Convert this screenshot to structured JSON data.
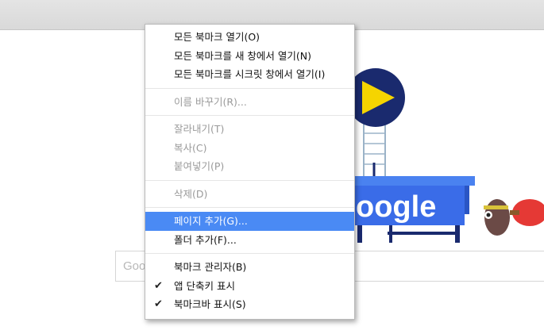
{
  "doodle": {
    "logo_text": "oogle",
    "colors": {
      "table_blue": "#3a6ce8",
      "play_circle": "#1a2a6e",
      "play_triangle": "#f5d400",
      "paddle_red": "#e53935"
    }
  },
  "search": {
    "partial_text": "Goo"
  },
  "menu": {
    "highlight_color": "#4a8af4",
    "groups": [
      [
        {
          "label": "모든 북마크 열기(O)",
          "disabled": false
        },
        {
          "label": "모든 북마크를 새 창에서 열기(N)",
          "disabled": false
        },
        {
          "label": "모든 북마크를 시크릿 창에서 열기(I)",
          "disabled": false
        }
      ],
      [
        {
          "label": "이름 바꾸기(R)...",
          "disabled": true
        }
      ],
      [
        {
          "label": "잘라내기(T)",
          "disabled": true
        },
        {
          "label": "복사(C)",
          "disabled": true
        },
        {
          "label": "붙여넣기(P)",
          "disabled": true
        }
      ],
      [
        {
          "label": "삭제(D)",
          "disabled": true
        }
      ],
      [
        {
          "label": "페이지 추가(G)...",
          "disabled": false,
          "selected": true
        },
        {
          "label": "폴더 추가(F)...",
          "disabled": false
        }
      ],
      [
        {
          "label": "북마크 관리자(B)",
          "disabled": false
        },
        {
          "label": "앱 단축키 표시",
          "disabled": false,
          "checked": true
        },
        {
          "label": "북마크바 표시(S)",
          "disabled": false,
          "checked": true
        }
      ]
    ]
  }
}
